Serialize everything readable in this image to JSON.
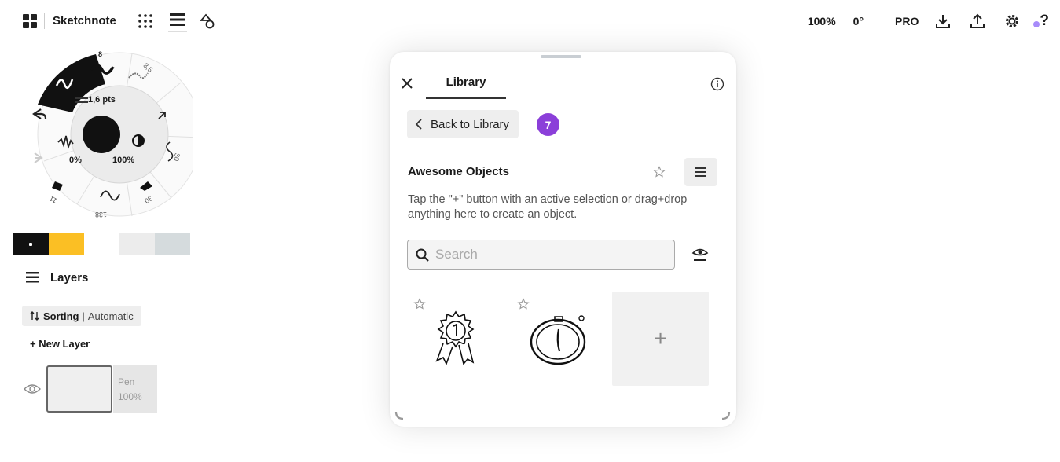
{
  "app": {
    "title": "Sketchnote"
  },
  "toolbar_right": {
    "zoom": "100%",
    "rotation": "0°",
    "pro_label": "PRO",
    "help_label": "?"
  },
  "brush_wheel": {
    "size_readout": "1,6 pts",
    "opacity_min": "0%",
    "opacity_max": "100%",
    "presets": [
      "1,6",
      "8",
      "3,5",
      "30",
      "30",
      "138",
      "11"
    ]
  },
  "colors": {
    "primary": "#000000",
    "secondary": "#fbbf24",
    "recent1": "#ececec",
    "recent2": "#d5dbdd",
    "accent": "#8b3fd9"
  },
  "layers": {
    "heading": "Layers",
    "sorting_label": "Sorting",
    "sorting_value": "Automatic",
    "new_layer_label": "+ New Layer",
    "items": [
      {
        "name": "Pen",
        "opacity": "100%"
      }
    ]
  },
  "library": {
    "tab_label": "Library",
    "back_label": "Back to Library",
    "badge_count": "7",
    "collection_title": "Awesome Objects",
    "description": "Tap the \"+\" button with an active selection or drag+drop anything here to create an object.",
    "search_placeholder": "Search",
    "objects": [
      {
        "icon": "ribbon-award-sketch-icon"
      },
      {
        "icon": "stopwatch-sketch-icon"
      }
    ],
    "add_label": "+"
  }
}
